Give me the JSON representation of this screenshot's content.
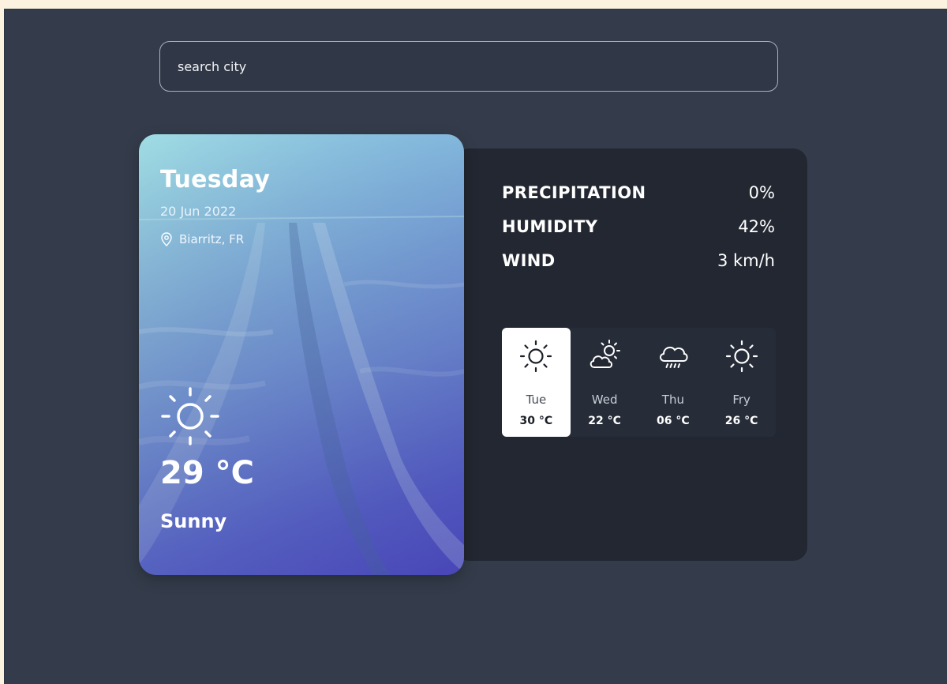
{
  "search": {
    "placeholder": "search city"
  },
  "current": {
    "day": "Tuesday",
    "date": "20 Jun 2022",
    "location": "Biarritz, FR",
    "icon": "sun-icon",
    "temperature": "29 °C",
    "condition": "Sunny"
  },
  "stats": [
    {
      "label": "PRECIPITATION",
      "value": "0%"
    },
    {
      "label": "HUMIDITY",
      "value": "42%"
    },
    {
      "label": "WIND",
      "value": "3 km/h"
    }
  ],
  "forecast": [
    {
      "day": "Tue",
      "temp": "30 °C",
      "icon": "sun-icon",
      "selected": true
    },
    {
      "day": "Wed",
      "temp": "22 °C",
      "icon": "partly-cloudy-icon",
      "selected": false
    },
    {
      "day": "Thu",
      "temp": "06 °C",
      "icon": "rain-cloud-icon",
      "selected": false
    },
    {
      "day": "Fry",
      "temp": "26 °C",
      "icon": "sun-icon",
      "selected": false
    }
  ],
  "colors": {
    "background": "#343c4b",
    "panel": "#222731",
    "selected_card": "#ffffff",
    "hero_gradient_top": "#8fd6de",
    "hero_gradient_bottom": "#5450c9"
  }
}
